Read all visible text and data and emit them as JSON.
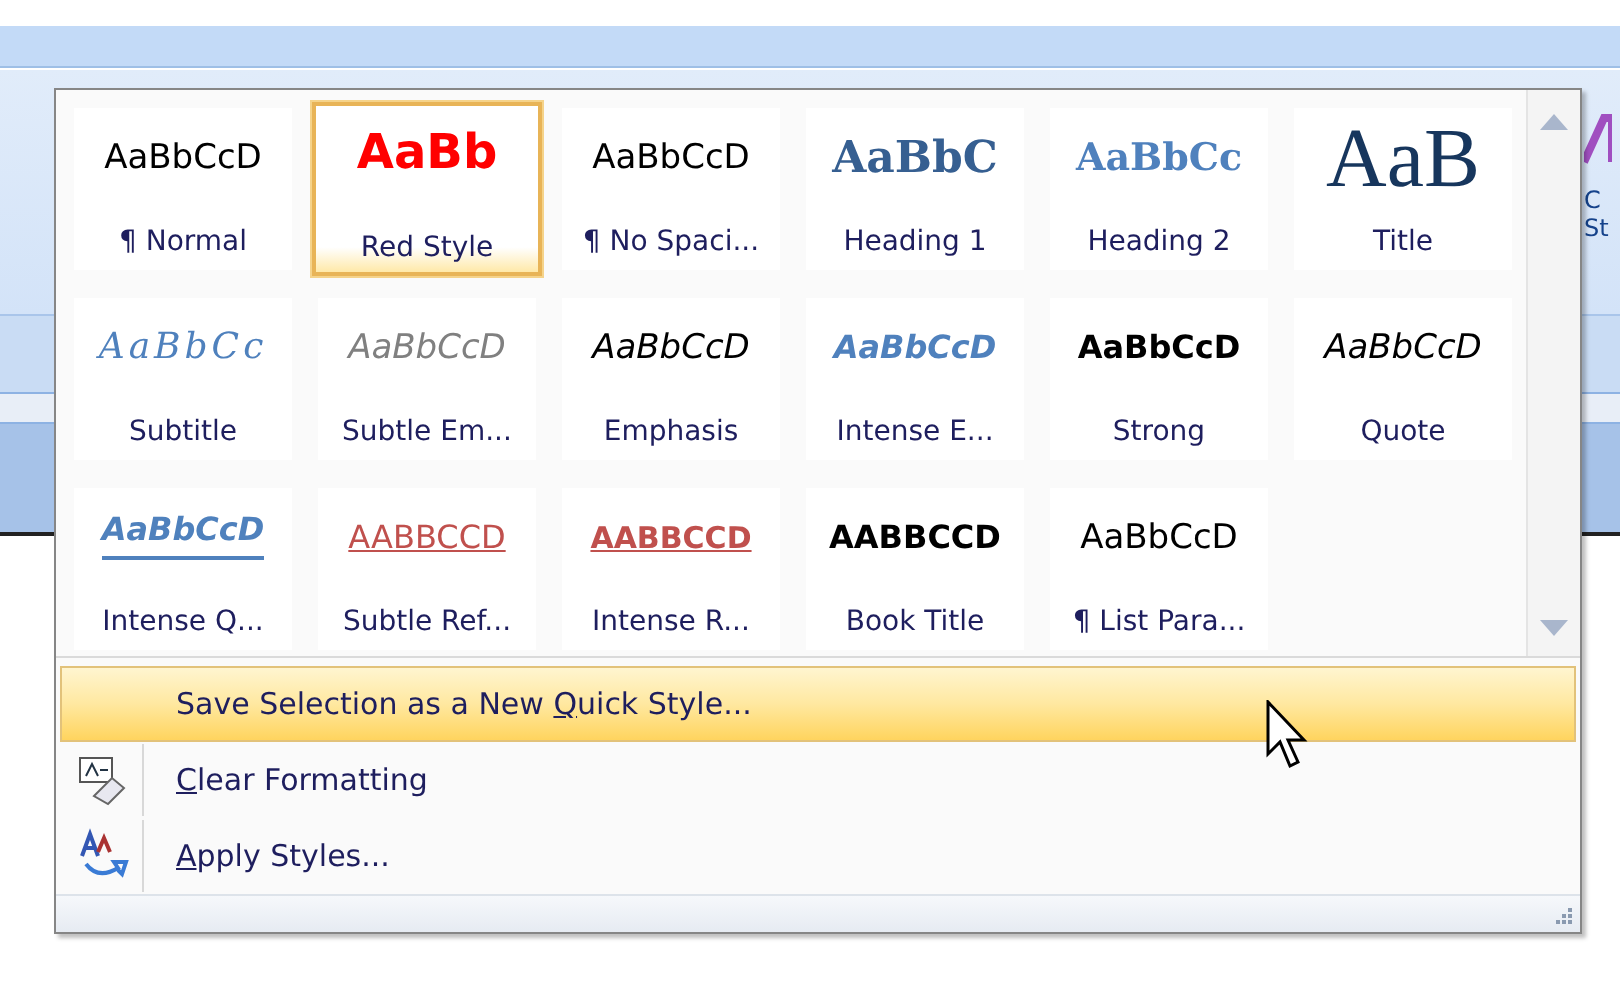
{
  "ribbon": {
    "change_styles_lines": [
      "C",
      "St"
    ]
  },
  "gallery": {
    "styles": [
      {
        "kind": "normal",
        "sample": "AaBbCcD",
        "label": "¶ Normal",
        "selected": false
      },
      {
        "kind": "red",
        "sample": "AaBb",
        "label": "Red Style",
        "selected": true
      },
      {
        "kind": "normal",
        "sample": "AaBbCcD",
        "label": "¶ No Spaci...",
        "selected": false
      },
      {
        "kind": "heading1",
        "sample": "AaBbC",
        "label": "Heading 1",
        "selected": false
      },
      {
        "kind": "heading2",
        "sample": "AaBbCc",
        "label": "Heading 2",
        "selected": false
      },
      {
        "kind": "title",
        "sample": "AaB",
        "label": "Title",
        "selected": false
      },
      {
        "kind": "subtitle",
        "sample": "AaBbCc",
        "label": "Subtitle",
        "selected": false
      },
      {
        "kind": "subtle",
        "sample": "AaBbCcD",
        "label": "Subtle Em...",
        "selected": false
      },
      {
        "kind": "emphasis",
        "sample": "AaBbCcD",
        "label": "Emphasis",
        "selected": false
      },
      {
        "kind": "intense",
        "sample": "AaBbCcD",
        "label": "Intense E...",
        "selected": false
      },
      {
        "kind": "strong",
        "sample": "AaBbCcD",
        "label": "Strong",
        "selected": false
      },
      {
        "kind": "emphasis",
        "sample": "AaBbCcD",
        "label": "Quote",
        "selected": false
      },
      {
        "kind": "intensequote",
        "sample": "AaBbCcD",
        "label": "Intense Q...",
        "selected": false
      },
      {
        "kind": "subtleref",
        "sample": "AABBCCD",
        "label": "Subtle Ref...",
        "selected": false
      },
      {
        "kind": "intenseref",
        "sample": "AABBCCD",
        "label": "Intense R...",
        "selected": false
      },
      {
        "kind": "strong",
        "sample": "AABBCCD",
        "label": "Book Title",
        "selected": false
      },
      {
        "kind": "normal",
        "sample": "AaBbCcD",
        "label": "¶ List Para...",
        "selected": false
      }
    ]
  },
  "menu": [
    {
      "kind": "save",
      "label_start": "Save Selection as a New ",
      "access_key": "Q",
      "label_end": "uick Style...",
      "selected": true
    },
    {
      "kind": "clear",
      "access_key": "C",
      "label_end": "lear Formatting",
      "selected": false
    },
    {
      "kind": "apply",
      "access_key": "A",
      "label_end": "pply Styles...",
      "selected": false
    }
  ]
}
